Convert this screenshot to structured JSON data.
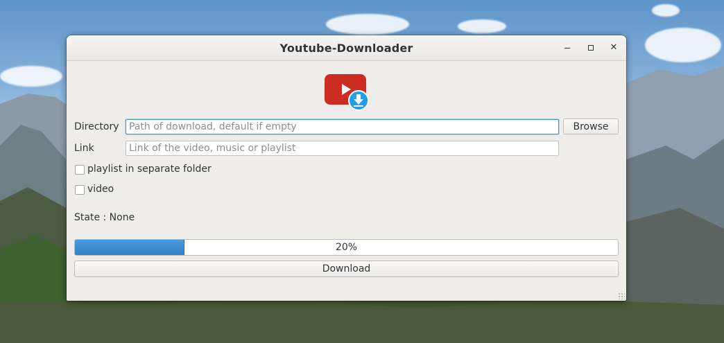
{
  "window": {
    "title": "Youtube-Downloader",
    "controls": {
      "minimize_icon": "minimize-icon",
      "maximize_icon": "maximize-icon",
      "close_icon": "close-icon"
    }
  },
  "logo": {
    "icon": "youtube-download-icon",
    "colors": {
      "red": "#cc2d23",
      "blue": "#1e9fe8"
    }
  },
  "form": {
    "directory_label": "Directory",
    "directory_placeholder": "Path of download, default if empty",
    "directory_value": "",
    "browse_label": "Browse",
    "link_label": "Link",
    "link_placeholder": "Link of the video, music or playlist",
    "link_value": "",
    "playlist_checkbox_label": "playlist in separate folder",
    "playlist_checked": false,
    "video_checkbox_label": "video",
    "video_checked": false
  },
  "state_text": "State : None",
  "progress": {
    "value": 0.2,
    "label": "20%",
    "color": "#2f7fc7"
  },
  "download_label": "Download"
}
